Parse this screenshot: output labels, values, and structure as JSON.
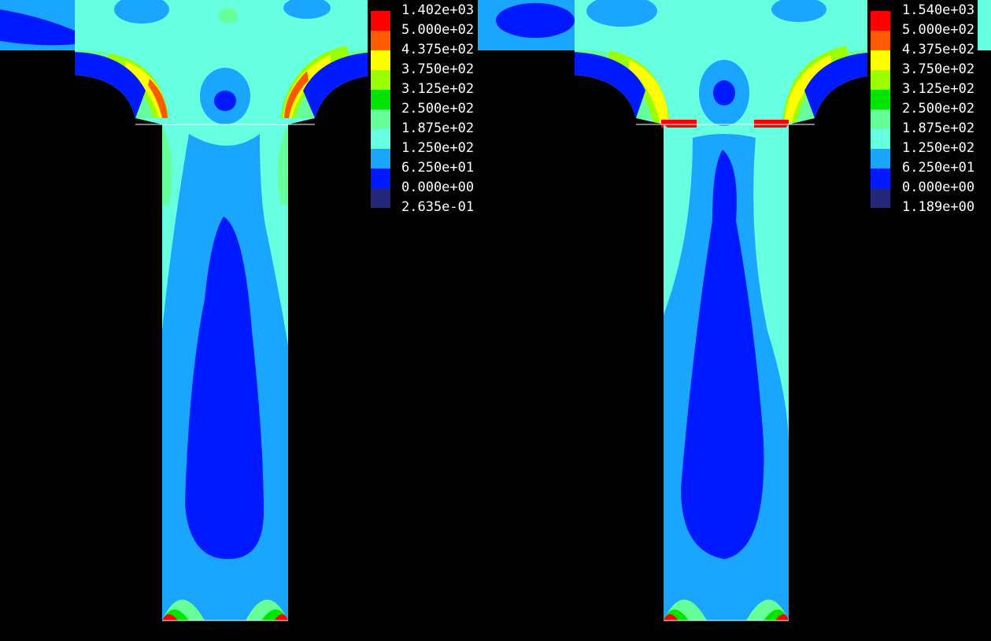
{
  "palette": {
    "background": "#000000",
    "band_red": "#ff0000",
    "band_orange": "#ff5a00",
    "band_yellow": "#ffff00",
    "band_lime": "#9cff00",
    "band_green": "#00e400",
    "band_paleGreen": "#66ff99",
    "band_cyan": "#66ffe0",
    "band_sky": "#1aa6ff",
    "band_blue": "#0019ff",
    "band_navy": "#25287a"
  },
  "panels": [
    {
      "legend": {
        "labels": [
          "1.402e+03",
          "5.000e+02",
          "4.375e+02",
          "3.750e+02",
          "3.125e+02",
          "2.500e+02",
          "1.875e+02",
          "1.250e+02",
          "6.250e+01",
          "0.000e+00",
          "2.635e-01"
        ]
      }
    },
    {
      "legend": {
        "labels": [
          "1.540e+03",
          "5.000e+02",
          "4.375e+02",
          "3.750e+02",
          "3.125e+02",
          "2.500e+02",
          "1.875e+02",
          "1.250e+02",
          "6.250e+01",
          "0.000e+00",
          "1.189e+00"
        ]
      }
    }
  ]
}
